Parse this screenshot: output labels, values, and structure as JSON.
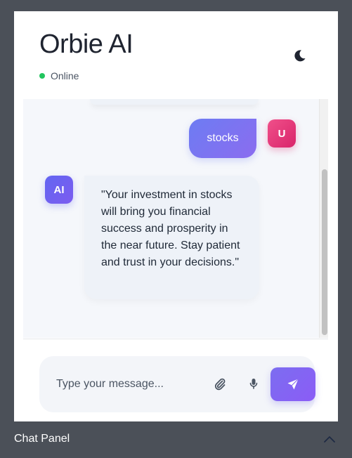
{
  "header": {
    "title": "Orbie AI",
    "status": "Online",
    "status_color": "#22c55e",
    "theme_toggle_icon": "moon-icon"
  },
  "messages": [
    {
      "role": "user",
      "avatar": "U",
      "text": "stocks"
    },
    {
      "role": "ai",
      "avatar": "AI",
      "text": "\"Your investment in stocks will bring you financial success and prosperity in the near future. Stay patient and trust in your decisions.\""
    }
  ],
  "composer": {
    "placeholder": "Type your message...",
    "value": "",
    "attach_icon": "paperclip-icon",
    "mic_icon": "microphone-icon",
    "send_icon": "send-icon"
  },
  "panel_bar": {
    "label": "Chat Panel",
    "toggle_icon": "chevron-up-icon"
  },
  "colors": {
    "accent": "#7c6df0",
    "user_avatar": "#e8407d",
    "ai_avatar": "#6366f1",
    "frame": "#4b5058"
  }
}
